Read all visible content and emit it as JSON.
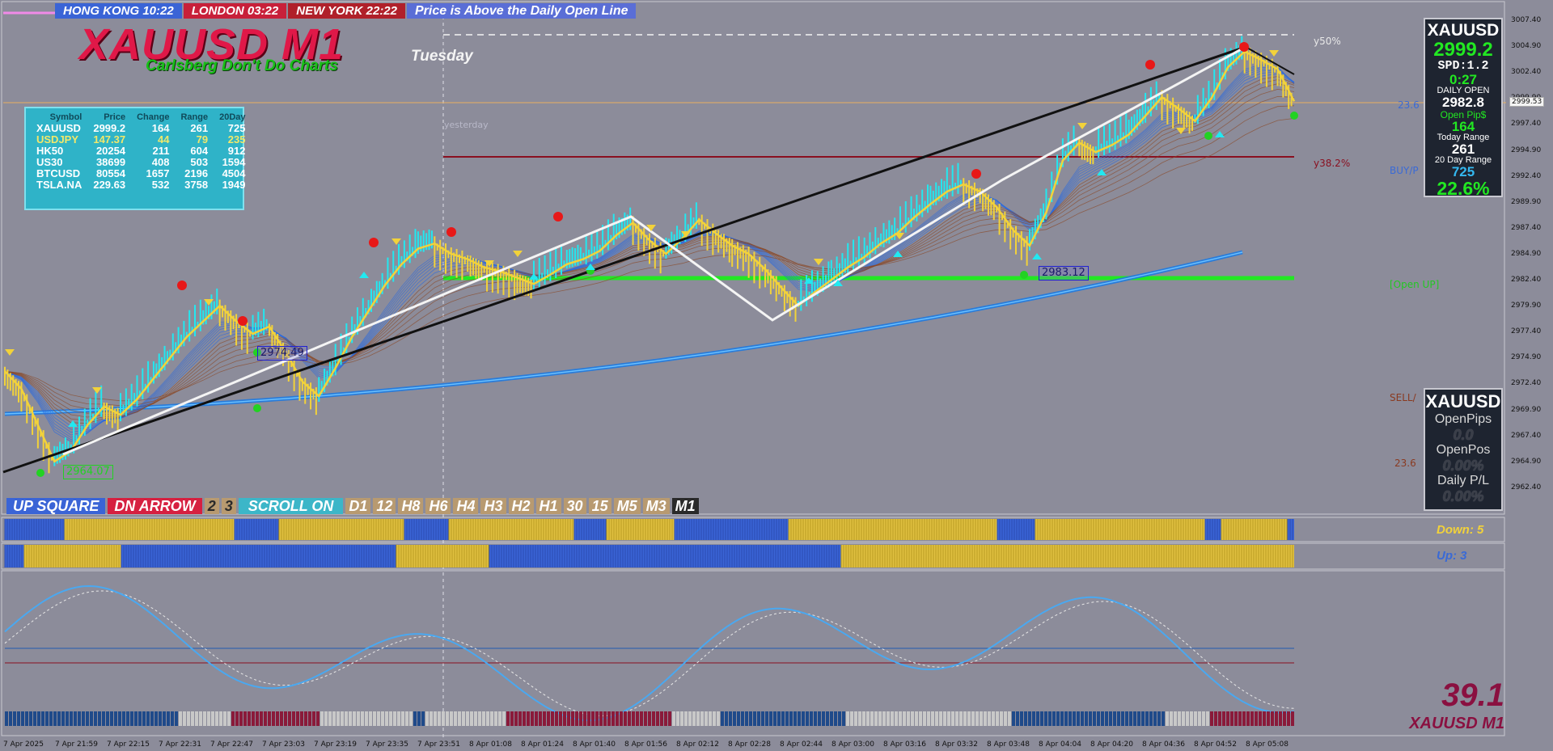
{
  "clocks": {
    "hong_kong": "HONG KONG 10:22",
    "london": "LONDON  03:22",
    "new_york": "NEW YORK 22:22",
    "message": "Price is Above the Daily Open Line"
  },
  "chart_title": "XAUUSD M1",
  "chart_subtitle": "Carlsberg Don't Do Charts",
  "day_label": "Tuesday",
  "yesterday_label": "yesterday",
  "quote_table": {
    "headers": [
      "Symbol",
      "Price",
      "Change",
      "Range",
      "20Day"
    ],
    "rows": [
      {
        "symbol": "XAUUSD",
        "price": "2999.2",
        "change": "164",
        "range": "261",
        "day20": "725"
      },
      {
        "symbol": "USDJPY",
        "price": "147.37",
        "change": "44",
        "range": "79",
        "day20": "235"
      },
      {
        "symbol": "HK50",
        "price": "20254",
        "change": "211",
        "range": "604",
        "day20": "912"
      },
      {
        "symbol": "US30",
        "price": "38699",
        "change": "408",
        "range": "503",
        "day20": "1594"
      },
      {
        "symbol": "BTCUSD",
        "price": "80554",
        "change": "1657",
        "range": "2196",
        "day20": "4504"
      },
      {
        "symbol": "TSLA.NA",
        "price": "229.63",
        "change": "532",
        "range": "3758",
        "day20": "1949"
      }
    ]
  },
  "info_panel": {
    "symbol": "XAUUSD",
    "price": "2999.2",
    "spread": "SPD:1.2",
    "timer": "0:27",
    "daily_open_label": "DAILY OPEN",
    "daily_open": "2982.8",
    "open_pips_label": "Open Pip$",
    "open_pips": "164",
    "today_range_label": "Today Range",
    "today_range": "261",
    "day20_range_label": "20 Day Range",
    "day20_range": "725",
    "percent": "22.6%"
  },
  "position_panel": {
    "symbol": "XAUUSD",
    "open_pips_label": "OpenPips",
    "open_pips": "0.0",
    "open_pos_label": "OpenPos",
    "open_pos": "0.00%",
    "daily_pl_label": "Daily P/L",
    "daily_pl": "0.00%"
  },
  "level_labels": {
    "y50": "y50%",
    "y382": "y38.2%",
    "fib_top": "23.6",
    "buy": "BUY/P",
    "open_up": "[Open UP]",
    "sell": "SELL/",
    "fib_bottom": "23.6"
  },
  "box_labels": {
    "low": "2964.07",
    "mid": "2983.12",
    "left": "2974.49"
  },
  "toolbar": {
    "up": "UP SQUARE",
    "dn": "DN ARROW",
    "n2": "2",
    "n3": "3",
    "scroll": "SCROLL ON",
    "timeframes": [
      "D1",
      "12",
      "H8",
      "H6",
      "H4",
      "H3",
      "H2",
      "H1",
      "30",
      "15",
      "M5",
      "M3",
      "M1"
    ]
  },
  "counts": {
    "down": "Down: 5",
    "up": "Up: 3"
  },
  "oscillator": {
    "value": "39.1",
    "symbol": "XAUUSD M1"
  },
  "price_axis": {
    "current_price_tag": "2999.53",
    "ticks": [
      "3007.40",
      "3004.90",
      "3002.40",
      "2999.90",
      "2997.40",
      "2994.90",
      "2992.40",
      "2989.90",
      "2987.40",
      "2984.90",
      "2982.40",
      "2979.90",
      "2977.40",
      "2974.90",
      "2972.40",
      "2969.90",
      "2967.40",
      "2964.90",
      "2962.40"
    ]
  },
  "time_axis": {
    "ticks": [
      "7 Apr 2025",
      "7 Apr 21:59",
      "7 Apr 22:15",
      "7 Apr 22:31",
      "7 Apr 22:47",
      "7 Apr 23:03",
      "7 Apr 23:19",
      "7 Apr 23:35",
      "7 Apr 23:51",
      "8 Apr 01:08",
      "8 Apr 01:24",
      "8 Apr 01:40",
      "8 Apr 01:56",
      "8 Apr 02:12",
      "8 Apr 02:28",
      "8 Apr 02:44",
      "8 Apr 03:00",
      "8 Apr 03:16",
      "8 Apr 03:32",
      "8 Apr 03:48",
      "8 Apr 04:04",
      "8 Apr 04:20",
      "8 Apr 04:36",
      "8 Apr 04:52",
      "8 Apr 05:08"
    ]
  },
  "colors": {
    "background": "#8c8c9a",
    "bull": "#22e8f0",
    "bear": "#f2d23a",
    "ma_blue": "#1f7ae0",
    "open_line": "#22e822",
    "fib_line": "#8a1020"
  },
  "price_series": [
    2973.2,
    2971.5,
    2968.0,
    2964.5,
    2965.5,
    2968.0,
    2969.8,
    2969.0,
    2970.5,
    2972.5,
    2974.5,
    2976.5,
    2978.0,
    2979.5,
    2978.0,
    2976.8,
    2977.5,
    2975.0,
    2972.2,
    2970.8,
    2973.5,
    2976.5,
    2979.0,
    2981.5,
    2983.5,
    2985.0,
    2985.5,
    2984.5,
    2984.0,
    2983.2,
    2982.8,
    2982.2,
    2981.6,
    2982.5,
    2983.5,
    2984.0,
    2984.8,
    2986.3,
    2987.5,
    2985.8,
    2984.5,
    2986.0,
    2987.8,
    2986.5,
    2985.3,
    2984.5,
    2983.0,
    2981.2,
    2979.5,
    2980.8,
    2982.0,
    2983.2,
    2984.2,
    2985.5,
    2986.5,
    2988.0,
    2989.3,
    2990.5,
    2991.2,
    2990.5,
    2989.0,
    2986.8,
    2985.3,
    2988.5,
    2993.5,
    2995.2,
    2994.3,
    2995.0,
    2996.0,
    2997.8,
    2999.6,
    2998.5,
    2997.3,
    2999.5,
    3002.5,
    3004.0,
    3003.2,
    3002.3,
    2999.2
  ]
}
